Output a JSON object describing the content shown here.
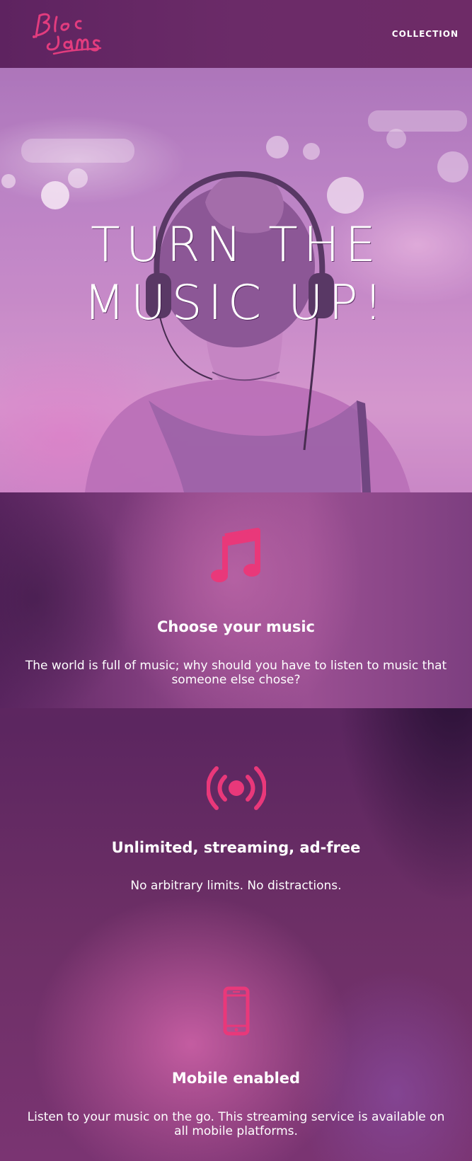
{
  "navbar": {
    "logo_text": "Bloc Jams",
    "links": [
      {
        "label": "COLLECTION"
      }
    ]
  },
  "hero": {
    "title_line1": "TURN THE",
    "title_line2": "MUSIC UP!"
  },
  "selling_points": [
    {
      "icon": "music-note-icon",
      "title": "Choose your music",
      "text": "The world is full of music; why should you have to listen to music that someone else chose?"
    },
    {
      "icon": "broadcast-icon",
      "title": "Unlimited, streaming, ad-free",
      "text": "No arbitrary limits. No distractions."
    },
    {
      "icon": "mobile-phone-icon",
      "title": "Mobile enabled",
      "text": "Listen to your music on the go. This streaming service is available on all mobile platforms."
    }
  ],
  "colors": {
    "accent": "#e9387a",
    "navbar": "#66275f",
    "text": "#ffffff"
  }
}
